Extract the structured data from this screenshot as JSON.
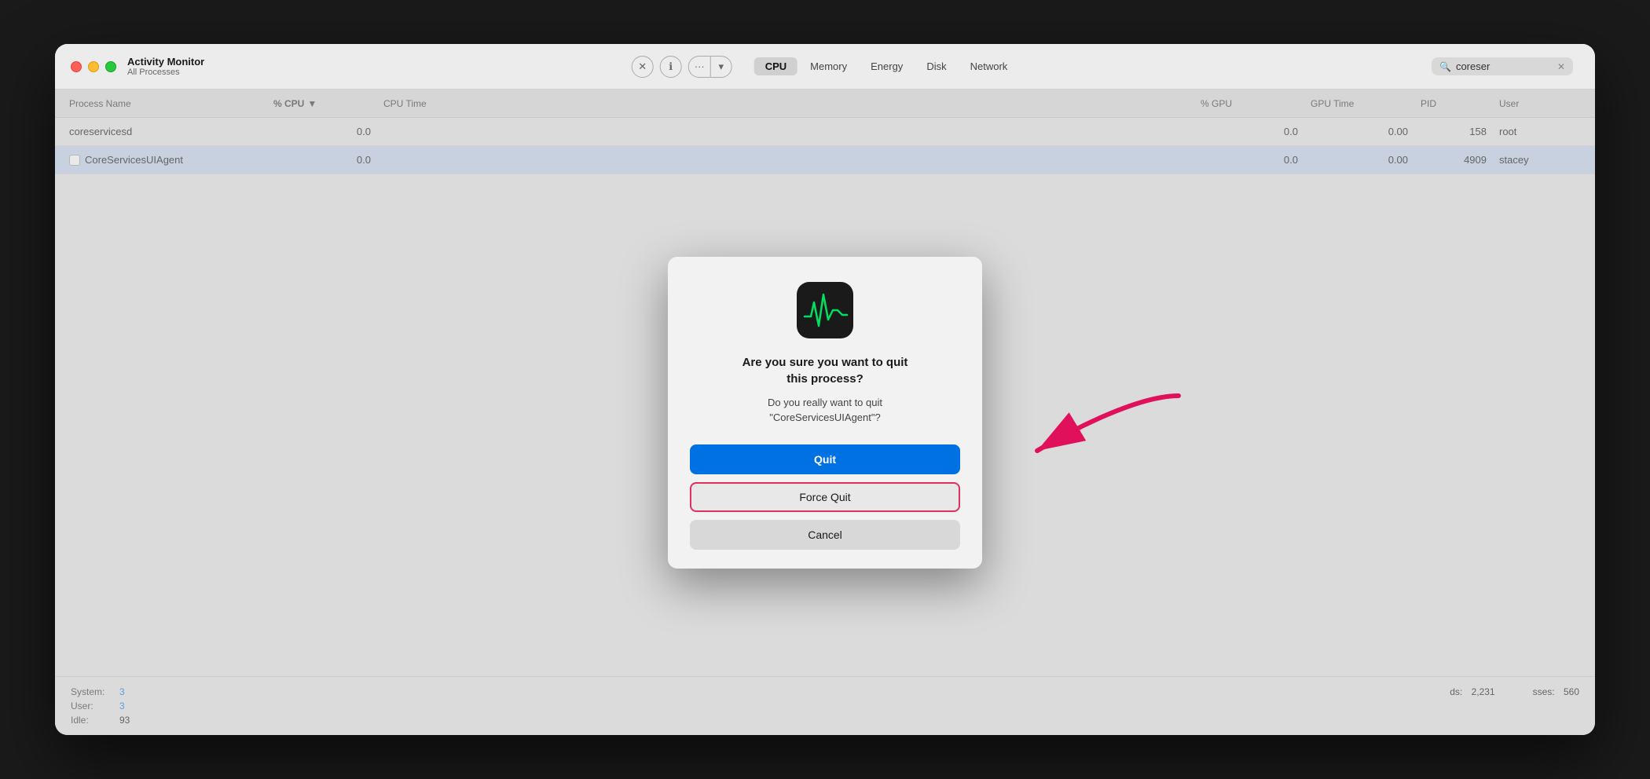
{
  "window": {
    "title": "Activity Monitor",
    "subtitle": "All Processes",
    "traffic_lights": {
      "close": "close",
      "minimize": "minimize",
      "maximize": "maximize"
    }
  },
  "toolbar": {
    "close_btn": "✕",
    "info_btn": "ℹ",
    "action_btn": "···",
    "tabs": [
      {
        "label": "CPU",
        "active": true
      },
      {
        "label": "Memory",
        "active": false
      },
      {
        "label": "Energy",
        "active": false
      },
      {
        "label": "Disk",
        "active": false
      },
      {
        "label": "Network",
        "active": false
      }
    ],
    "search_placeholder": "coreser",
    "search_value": "coreser"
  },
  "table": {
    "columns": [
      {
        "label": "Process Name",
        "sorted": false
      },
      {
        "label": "% CPU",
        "sorted": true
      },
      {
        "label": "CPU Time",
        "sorted": false
      },
      {
        "label": "",
        "sorted": false
      },
      {
        "label": "% GPU",
        "sorted": false
      },
      {
        "label": "GPU Time",
        "sorted": false
      },
      {
        "label": "PID",
        "sorted": false
      },
      {
        "label": "User",
        "sorted": false
      }
    ],
    "rows": [
      {
        "name": "coreservicesd",
        "cpu_pct": "0.0",
        "cpu_time": "",
        "gpu_pct": "0.0",
        "gpu_time": "0.00",
        "pid": "158",
        "user": "root",
        "selected": false
      },
      {
        "name": "CoreServicesUIAgent",
        "cpu_pct": "0.0",
        "cpu_time": "",
        "gpu_pct": "0.0",
        "gpu_time": "0.00",
        "pid": "4909",
        "user": "stacey",
        "selected": true
      }
    ]
  },
  "bottom_stats": {
    "system_label": "System:",
    "system_value": "3",
    "user_label": "User:",
    "user_value": "3",
    "idle_label": "Idle:",
    "idle_value": "93",
    "threads_label": "ds:",
    "threads_value": "2,231",
    "processes_label": "sses:",
    "processes_value": "560"
  },
  "dialog": {
    "title": "Are you sure you want to quit\nthis process?",
    "message": "Do you really want to quit\n\"CoreServicesUIAgent\"?",
    "quit_btn": "Quit",
    "force_quit_btn": "Force Quit",
    "cancel_btn": "Cancel"
  }
}
